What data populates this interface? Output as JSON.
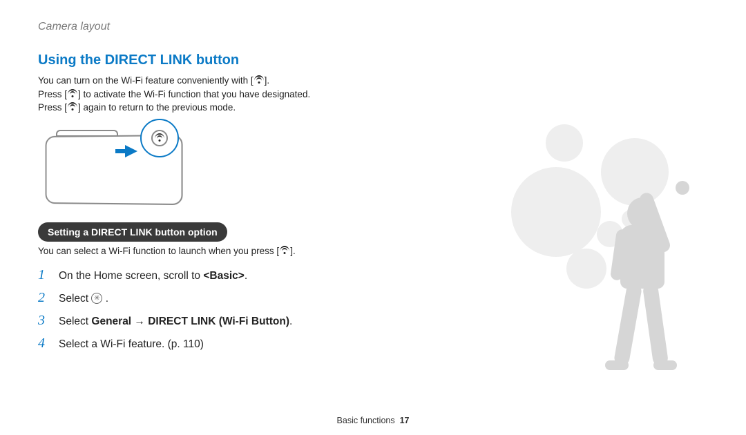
{
  "breadcrumb": "Camera layout",
  "section_title": "Using the DIRECT LINK button",
  "intro": {
    "line1_a": "You can turn on the Wi-Fi feature conveniently with [",
    "line1_b": "].",
    "line2_a": "Press [",
    "line2_b": "] to activate the Wi-Fi function that you have designated.",
    "line3_a": "Press [",
    "line3_b": "] again to return to the previous mode."
  },
  "pill_heading": "Setting a DIRECT LINK button option",
  "pill_sub_a": "You can select a Wi-Fi function to launch when you press [",
  "pill_sub_b": "].",
  "steps": {
    "s1": {
      "num": "1",
      "pre": "On the Home screen, scroll to ",
      "bold": "<Basic>",
      "post": "."
    },
    "s2": {
      "num": "2",
      "pre": "Select ",
      "post": " ."
    },
    "s3": {
      "num": "3",
      "pre": "Select ",
      "bold": "General → DIRECT LINK (Wi-Fi Button)",
      "post": "."
    },
    "s4": {
      "num": "4",
      "pre": "Select a Wi-Fi feature. (p. 110)"
    }
  },
  "footer": {
    "section": "Basic functions",
    "page": "17"
  },
  "icons": {
    "wifi": "wifi-icon",
    "settings": "settings-icon"
  }
}
